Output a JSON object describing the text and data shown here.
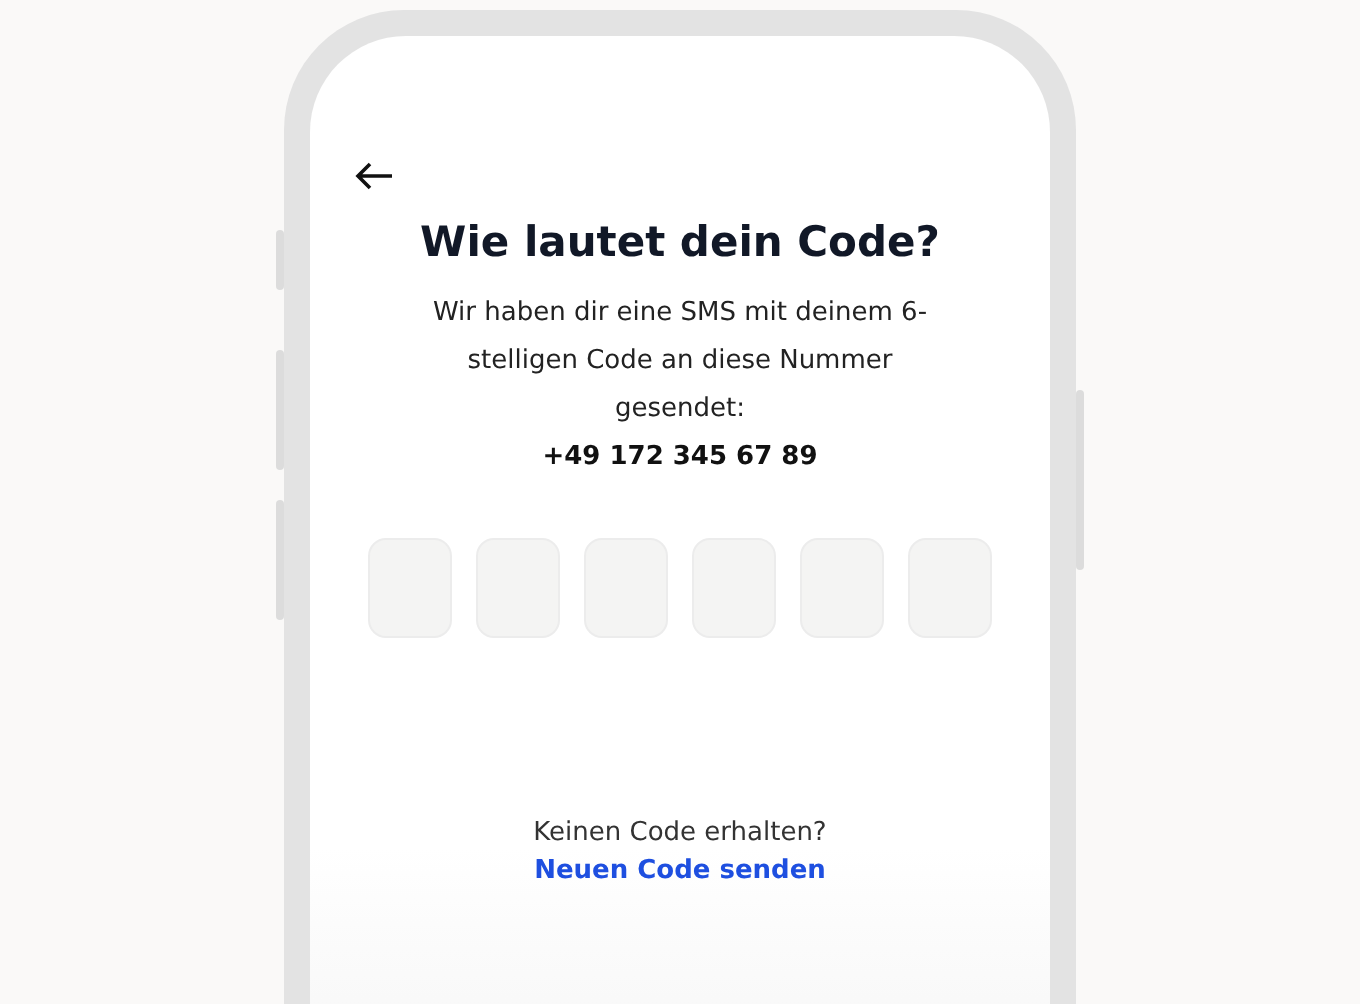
{
  "screen": {
    "title": "Wie lautet dein Code?",
    "message": "Wir haben dir eine SMS mit deinem 6-stelligen Code an diese Nummer gesendet:",
    "phone_number": "+49 172 345 67 89"
  },
  "code_fields": [
    {
      "filled": false
    },
    {
      "filled": false
    },
    {
      "filled": false
    },
    {
      "filled": false
    },
    {
      "filled": false
    },
    {
      "filled": false
    }
  ],
  "resend": {
    "question": "Keinen Code erhalten?",
    "link": "Neuen Code senden"
  }
}
